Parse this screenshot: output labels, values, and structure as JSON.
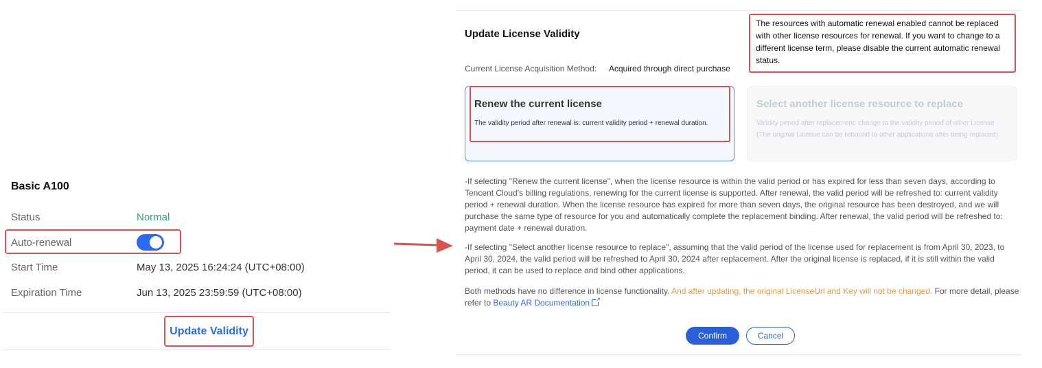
{
  "left_card": {
    "title": "Basic A100",
    "status_label": "Status",
    "status_value": "Normal",
    "auto_renewal_label": "Auto-renewal",
    "auto_renewal_on": true,
    "start_label": "Start Time",
    "start_value": "May 13, 2025 16:24:24 (UTC+08:00)",
    "expiration_label": "Expiration Time",
    "expiration_value": "Jun 13, 2025 23:59:59 (UTC+08:00)",
    "update_link": "Update Validity"
  },
  "dialog": {
    "title": "Update License Validity",
    "tooltip": "The resources with automatic renewal enabled cannot be replaced with other license resources for renewal. If you want to change to a different license term, please disable the current automatic renewal status.",
    "acquisition_label": "Current License Acquisition Method:",
    "acquisition_value": "Acquired through direct purchase",
    "options": [
      {
        "title": "Renew the current license",
        "desc": "The validity period after renewal is: current validity period + renewal duration.",
        "selected": true
      },
      {
        "title": "Select another license resource to replace",
        "desc": "Validity period after replacement: change to the validity period of other License (The original License can be rebound to other applications after being replaced).",
        "selected": false
      }
    ],
    "para1": "-If selecting \"Renew the current license\", when the license resource is within the valid period or has expired for less than seven days, according to Tencent Cloud's billing regulations, renewing for the current license is supported. After renewal, the valid period will be refreshed to: current validity period + renewal duration. When the license resource has expired for more than seven days, the original resource has been destroyed, and we will purchase the same type of resource for you and automatically complete the replacement binding. After renewal, the valid period will be refreshed to: payment date + renewal duration.",
    "para2": "-If selecting \"Select another license resource to replace\", assuming that the valid period of the license used for replacement is from April 30, 2023, to April 30, 2024, the valid period will be refreshed to April 30, 2024 after replacement. After the original license is replaced, if it is still within the valid period, it can be used to replace and bind other applications.",
    "para3_start": "Both methods have no difference in license functionality. ",
    "para3_highlight": "And after updating, the original LicenseUrl and Key will not be changed.",
    "para3_mid": " For more detail, please refer to ",
    "para3_link": "Beauty AR Documentation",
    "confirm_label": "Confirm",
    "cancel_label": "Cancel"
  },
  "colors": {
    "accent": "#2b6bf3",
    "status_normal": "#2ba471",
    "highlight_orange": "#e59a3b",
    "annotation_red": "#d9534f"
  },
  "icons": {
    "external_link": "external-link-icon",
    "arrow": "arrow-right-icon"
  }
}
